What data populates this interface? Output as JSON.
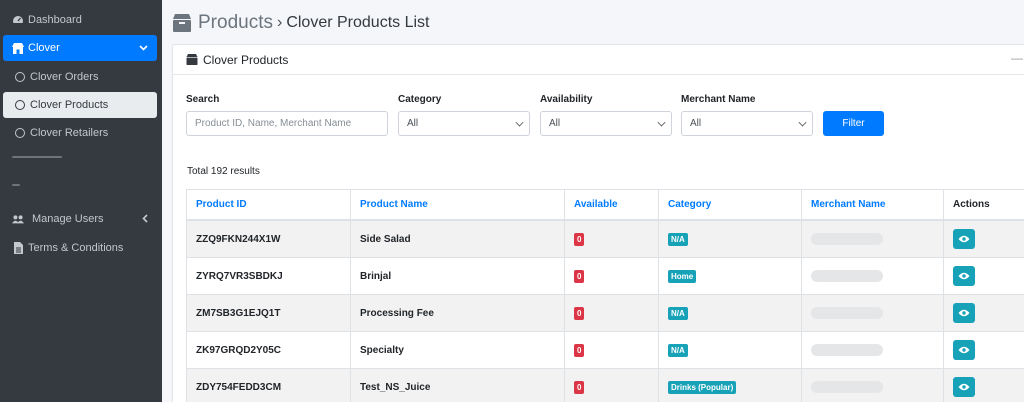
{
  "sidebar": {
    "dashboard": "Dashboard",
    "clover": "Clover",
    "clover_orders": "Clover Orders",
    "clover_products": "Clover Products",
    "clover_retailers": "Clover Retailers",
    "manage_users": "Manage Users",
    "terms": "Terms & Conditions"
  },
  "header": {
    "title": "Products",
    "separator": "›",
    "subtitle": "Clover Products List"
  },
  "card": {
    "title": "Clover Products",
    "collapse": "—"
  },
  "filters": {
    "search_label": "Search",
    "search_placeholder": "Product ID, Name, Merchant Name",
    "category_label": "Category",
    "category_value": "All",
    "availability_label": "Availability",
    "availability_value": "All",
    "merchant_label": "Merchant Name",
    "merchant_value": "All",
    "filter_button": "Filter"
  },
  "total": "Total 192 results",
  "table": {
    "headers": [
      "Product ID",
      "Product Name",
      "Available",
      "Category",
      "Merchant Name",
      "Actions"
    ],
    "rows": [
      {
        "id": "ZZQ9FKN244X1W",
        "name": "Side Salad",
        "available": "0",
        "category": "N/A"
      },
      {
        "id": "ZYRQ7VR3SBDKJ",
        "name": "Brinjal",
        "available": "0",
        "category": "Home"
      },
      {
        "id": "ZM7SB3G1EJQ1T",
        "name": "Processing Fee",
        "available": "0",
        "category": "N/A"
      },
      {
        "id": "ZK97GRQD2Y05C",
        "name": "Specialty",
        "available": "0",
        "category": "N/A"
      },
      {
        "id": "ZDY754FEDD3CM",
        "name": "Test_NS_Juice",
        "available": "0",
        "category": "Drinks (Popular)"
      }
    ]
  },
  "colors": {
    "primary": "#007bff",
    "sidebar_bg": "#343a40",
    "danger": "#dc3545",
    "info": "#17a2b8"
  },
  "icons": {
    "dashboard": "dashboard-icon",
    "clover": "store-icon",
    "users": "users-icon",
    "terms": "file-icon",
    "view": "eye-icon",
    "products": "box-icon"
  }
}
